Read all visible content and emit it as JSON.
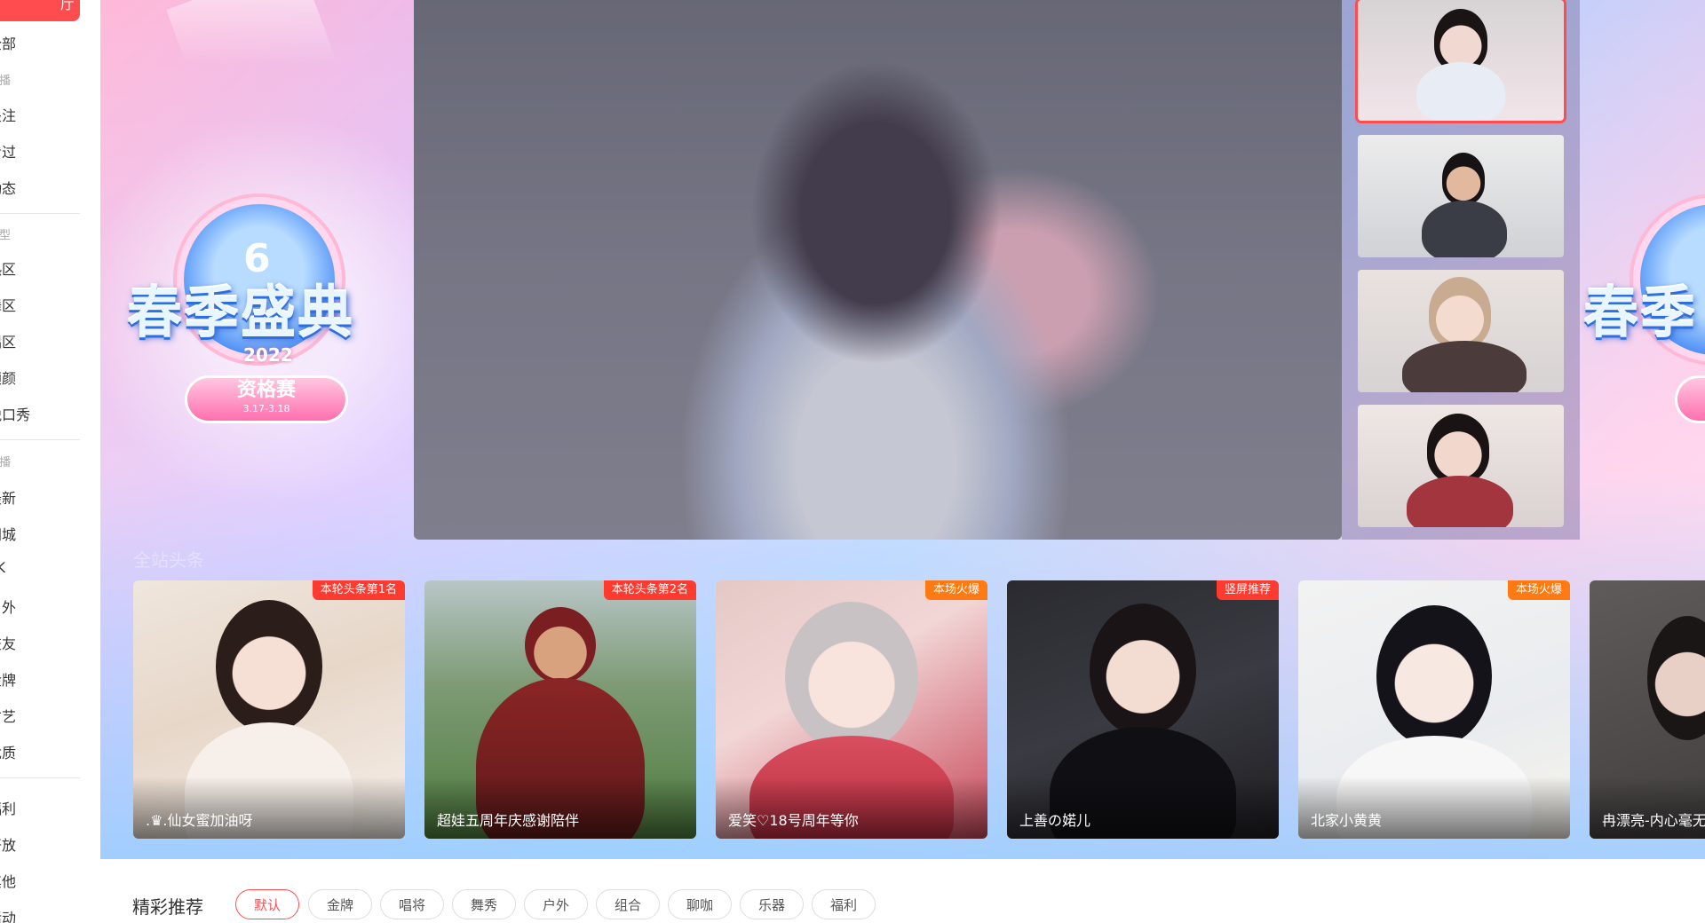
{
  "sidebar": {
    "active_label": "厅",
    "items": [
      {
        "label": "全部"
      },
      {
        "label": "关注"
      },
      {
        "label": "看过"
      },
      {
        "label": "动态"
      },
      {
        "label": "热区"
      },
      {
        "label": "舞区"
      },
      {
        "label": "唱区"
      },
      {
        "label": "颜颜"
      },
      {
        "label": "脱口秀"
      },
      {
        "label": "最新"
      },
      {
        "label": "同城"
      },
      {
        "label": "PK"
      },
      {
        "label": "户外"
      },
      {
        "label": "交友"
      },
      {
        "label": "金牌"
      },
      {
        "label": "才艺"
      },
      {
        "label": "优质"
      },
      {
        "label": "福利"
      },
      {
        "label": "开放"
      },
      {
        "label": "其他"
      },
      {
        "label": "活动"
      }
    ],
    "groups": [
      "主播",
      "类型",
      "主播"
    ]
  },
  "banner": {
    "event_number": "6",
    "event_title": "春季盛典",
    "event_year": "2022",
    "event_stage": "资格赛",
    "event_dates": "3.17-3.18",
    "event_title_right": "春季"
  },
  "cards_section": {
    "title": "全站头条",
    "cards": [
      {
        "name": ".♛.仙女蜜加油呀",
        "tag": "本轮头条第1名",
        "tag_color": "red"
      },
      {
        "name": "超娃五周年庆感谢陪伴",
        "tag": "本轮头条第2名",
        "tag_color": "red"
      },
      {
        "name": "爱笑♡18号周年等你",
        "tag": "本场火爆",
        "tag_color": "orange"
      },
      {
        "name": "上善の婼儿",
        "tag": "竖屏推荐",
        "tag_color": "red"
      },
      {
        "name": "北家小黄黄",
        "tag": "本场火爆",
        "tag_color": "orange"
      },
      {
        "name": "冉漂亮-内心毫无",
        "tag": "",
        "tag_color": ""
      }
    ]
  },
  "recommend": {
    "title": "精彩推荐",
    "filters": [
      "默认",
      "金牌",
      "唱将",
      "舞秀",
      "户外",
      "组合",
      "聊咖",
      "乐器",
      "福利"
    ],
    "active_filter": "默认"
  },
  "colors": {
    "accent": "#ff4d4f",
    "tag_red": "#ff3b30",
    "tag_orange": "#ff7a12"
  }
}
